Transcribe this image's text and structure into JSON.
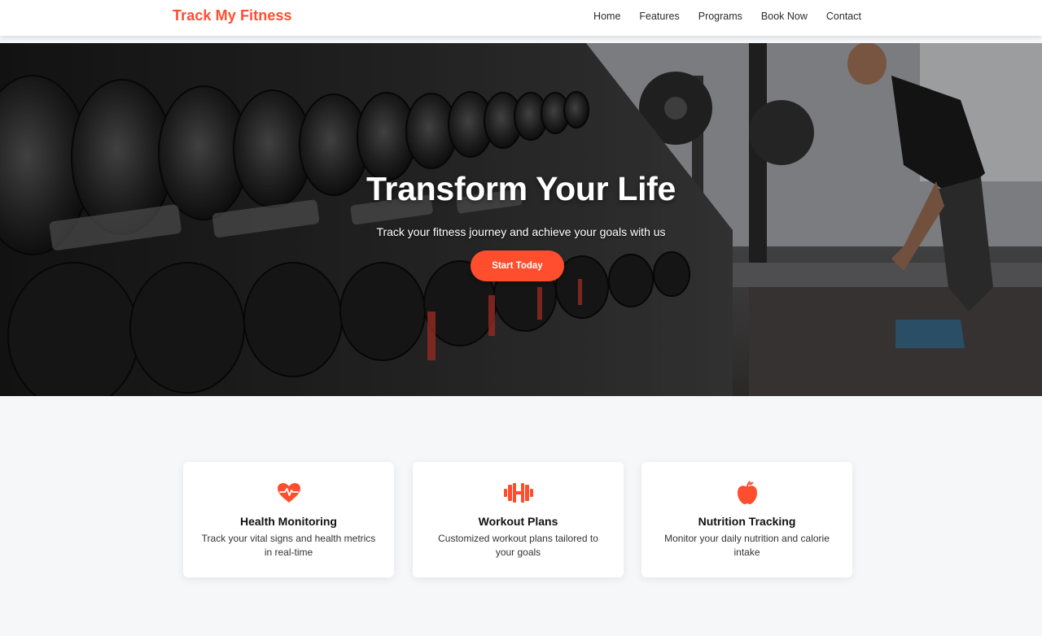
{
  "nav": {
    "brand": "Track My Fitness",
    "links": [
      "Home",
      "Features",
      "Programs",
      "Book Now",
      "Contact"
    ]
  },
  "hero": {
    "title": "Transform Your Life",
    "subtitle": "Track your fitness journey and achieve your goals with us",
    "cta_label": "Start Today"
  },
  "features": [
    {
      "icon": "heartbeat-icon",
      "title": "Health Monitoring",
      "text": "Track your vital signs and health metrics in real-time"
    },
    {
      "icon": "dumbbell-icon",
      "title": "Workout Plans",
      "text": "Customized workout plans tailored to your goals"
    },
    {
      "icon": "apple-icon",
      "title": "Nutrition Tracking",
      "text": "Monitor your daily nutrition and calorie intake"
    }
  ],
  "colors": {
    "accent": "#ff4e2e",
    "page_bg": "#f6f7f9"
  }
}
